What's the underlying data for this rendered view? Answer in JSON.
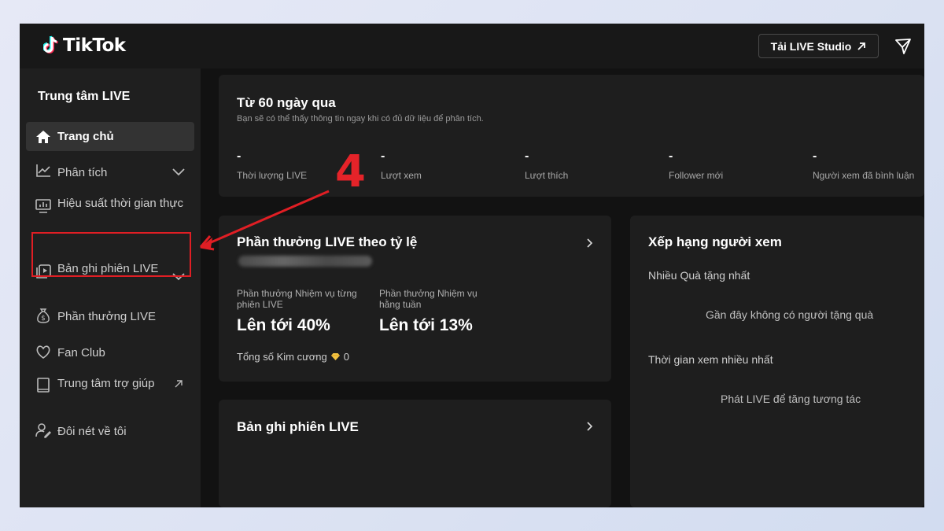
{
  "app": {
    "brand": "TikTok"
  },
  "header": {
    "studio_button": "Tải LIVE Studio"
  },
  "sidebar": {
    "title": "Trung tâm LIVE",
    "items": [
      {
        "label": "Trang chủ"
      },
      {
        "label": "Phân tích"
      },
      {
        "label": "Hiệu suất thời gian thực"
      },
      {
        "label": "Bản ghi phiên LIVE"
      },
      {
        "label": "Phần thưởng LIVE"
      },
      {
        "label": "Fan Club"
      },
      {
        "label": "Trung tâm trợ giúp"
      },
      {
        "label": "Đôi nét về tôi"
      }
    ]
  },
  "summary": {
    "title": "Từ 60 ngày qua",
    "subtitle": "Bạn sẽ có thể thấy thông tin ngay khi có đủ dữ liệu để phân tích.",
    "stats": [
      {
        "value": "-",
        "label": "Thời lượng LIVE"
      },
      {
        "value": "-",
        "label": "Lượt xem"
      },
      {
        "value": "-",
        "label": "Lượt thích"
      },
      {
        "value": "-",
        "label": "Follower mới"
      },
      {
        "value": "-",
        "label": "Người xem đã bình luận"
      }
    ]
  },
  "rewards": {
    "title": "Phần thưởng LIVE theo tỷ lệ",
    "mission_per_session_label": "Phần thưởng Nhiệm vụ từng phiên LIVE",
    "mission_per_session_value": "Lên tới 40%",
    "mission_weekly_label": "Phần thưởng Nhiệm vụ hằng tuần",
    "mission_weekly_value": "Lên tới 13%",
    "diamonds_label": "Tổng số Kim cương",
    "diamonds_value": "0"
  },
  "ranking": {
    "title": "Xếp hạng người xem",
    "most_gifts_label": "Nhiều Quà tặng nhất",
    "most_gifts_empty": "Gần đây không có người tặng quà",
    "longest_watch_label": "Thời gian xem nhiều nhất",
    "longest_watch_empty": "Phát LIVE để tăng tương tác"
  },
  "recordings": {
    "title": "Bản ghi phiên LIVE"
  },
  "annotation": {
    "step_number": "4",
    "color": "#e01e24"
  },
  "colors": {
    "background": "#181818",
    "card": "#1e1e1e",
    "accent_red": "#fe2c55",
    "accent_cyan": "#25f4ee"
  }
}
